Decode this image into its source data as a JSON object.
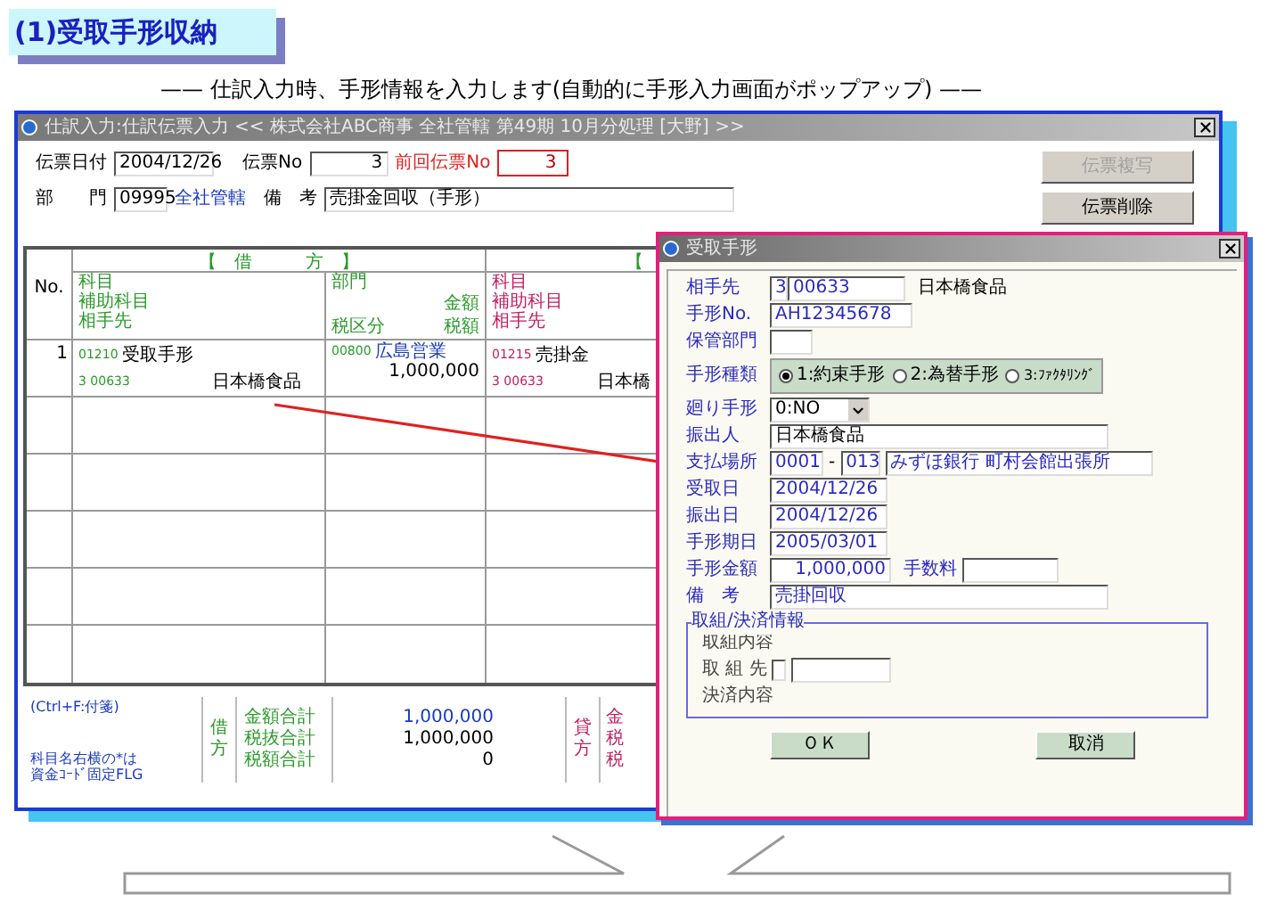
{
  "heading": "(1)受取手形収納",
  "subtitle": "——  仕訳入力時、手形情報を入力します(自動的に手形入力画面がポップアップ)  ——",
  "window": {
    "title": "仕訳入力:仕訳伝票入力  <<  株式会社ABC商事 全社管轄  第49期 10月分処理 [大野]  >>"
  },
  "form": {
    "date_label": "伝票日付",
    "date": "2004/12/26",
    "no_label": "伝票No",
    "no": "3",
    "prev_label": "前回伝票No",
    "prev": "3",
    "dept_label": "部　　門",
    "dept_code": "09995",
    "dept_name": "全社管轄",
    "memo_label": "備　考",
    "memo": "売掛金回収（手形）"
  },
  "buttons": [
    {
      "label": "伝票複写",
      "disabled": true
    },
    {
      "label": "伝票削除",
      "disabled": false
    }
  ],
  "table": {
    "no_header": "No.",
    "debit_header": "【　借　　　方　】",
    "credit_header": "【",
    "debit_account_header": [
      "科目",
      "補助科目",
      "相手先"
    ],
    "dept_header": {
      "dept": "部門",
      "amount": "金額",
      "tax_class": "税区分",
      "tax": "税額"
    },
    "credit_account_header": [
      "科目",
      "補助科目",
      "相手先"
    ],
    "rows": [
      {
        "no": "1",
        "debit_code": "01210",
        "debit_account": "受取手形",
        "debit_partner_code": "3 00633",
        "debit_partner": "日本橋食品",
        "dept_code": "00800",
        "dept_name": "広島営業",
        "amount": "1,000,000",
        "credit_code": "01215",
        "credit_account": "売掛金",
        "credit_partner_code": "3 00633",
        "credit_partner": "日本橋"
      }
    ]
  },
  "footer": {
    "hint": "(Ctrl+F:付箋)",
    "notes": [
      "科目名右横の*は",
      "資金ｺｰﾄﾞ固定FLG"
    ],
    "debit_side": [
      "借",
      "方"
    ],
    "labels": [
      "金額合計",
      "税抜合計",
      "税額合計"
    ],
    "values": [
      "1,000,000",
      "1,000,000",
      "0"
    ],
    "credit_side": [
      "貸",
      "方"
    ],
    "credit_labels": [
      "金",
      "税",
      "税"
    ]
  },
  "dialog": {
    "title": "受取手形",
    "partner_label": "相手先",
    "partner_code1": "3",
    "partner_code2": "00633",
    "partner_name": "日本橋食品",
    "note_no_label": "手形No.",
    "note_no": "AH12345678",
    "custody_label": "保管部門",
    "type_label": "手形種類",
    "type_options": [
      {
        "label": "1:約束手形",
        "selected": true
      },
      {
        "label": "2:為替手形",
        "selected": false
      },
      {
        "label": "3:ﾌｧｸﾀﾘﾝｸﾞ",
        "selected": false
      }
    ],
    "endorsed_label": "廻り手形",
    "endorsed": "0:NO",
    "drawer_label": "振出人",
    "drawer": "日本橋食品",
    "place_label": "支払場所",
    "bank_code": "0001",
    "place_separator": "-",
    "branch_code": "013",
    "place": "みずほ銀行 町村会館出張所",
    "dates": [
      {
        "label": "受取日",
        "value": "2004/12/26"
      },
      {
        "label": "振出日",
        "value": "2004/12/26"
      },
      {
        "label": "手形期日",
        "value": "2005/03/01"
      }
    ],
    "amount_label": "手形金額",
    "amount": "1,000,000",
    "fee_label": "手数料",
    "memo_label": "備　考",
    "memo": "売掛回収",
    "group": {
      "title": "取組/決済情報",
      "content_label": "取組内容",
      "party_label": "取 組 先",
      "party_checked": false,
      "settle_label": "決済内容"
    },
    "buttons": [
      "ＯＫ",
      "取消"
    ]
  }
}
